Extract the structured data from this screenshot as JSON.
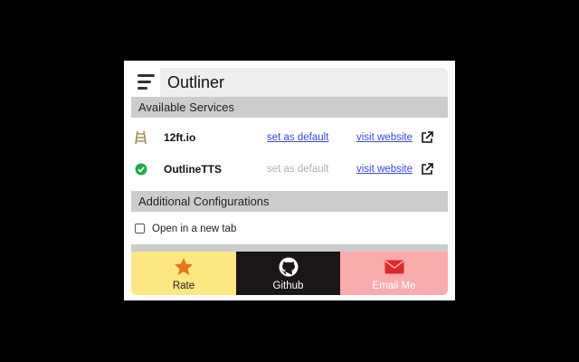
{
  "app": {
    "title": "Outliner"
  },
  "icons": {
    "menu": "hamburger-menu-icon",
    "external": "external-link-icon",
    "rate": "star-icon",
    "github": "github-icon",
    "email": "envelope-icon"
  },
  "sections": {
    "services_heading": "Available Services",
    "config_heading": "Additional Configurations"
  },
  "services": [
    {
      "name": "12ft.io",
      "icon": "ladder-icon",
      "set_default_label": "set as default",
      "set_default_enabled": true,
      "visit_label": "visit website"
    },
    {
      "name": "OutlineTTS",
      "icon": "check-circle-icon",
      "set_default_label": "set as default",
      "set_default_enabled": false,
      "visit_label": "visit website",
      "is_default": true
    }
  ],
  "config": {
    "open_new_tab_label": "Open in a new tab",
    "open_new_tab_checked": false
  },
  "footer": {
    "rate_label": "Rate",
    "github_label": "Github",
    "email_label": "Email Me"
  },
  "colors": {
    "rate_bg": "#fce782",
    "github_bg": "#1b1717",
    "email_bg": "#f9acab",
    "star": "#e8731c",
    "envelope": "#e0262b",
    "check": "#1fa84a",
    "link": "#3b47d6"
  }
}
